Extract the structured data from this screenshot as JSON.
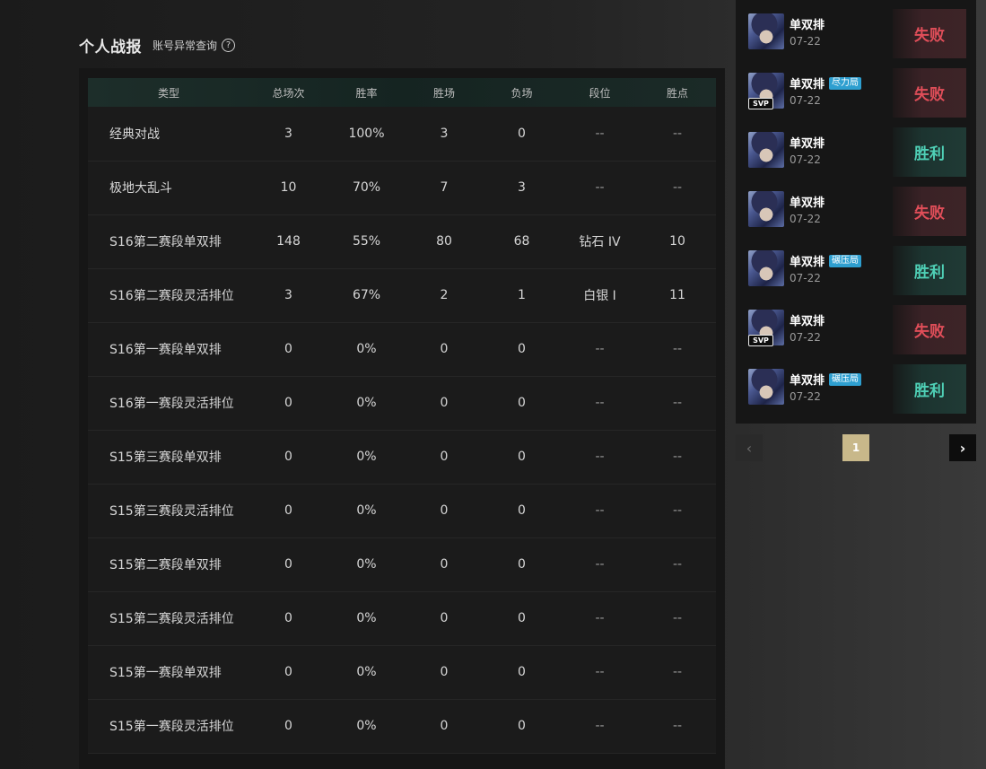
{
  "stats": {
    "title": "个人战报",
    "abnormal_link": "账号异常查询",
    "help_icon": "?",
    "columns": [
      "类型",
      "总场次",
      "胜率",
      "胜场",
      "负场",
      "段位",
      "胜点"
    ],
    "rows": [
      {
        "type": "经典对战",
        "total": "3",
        "winrate": "100%",
        "wins": "3",
        "losses": "0",
        "rank": "--",
        "lp": "--"
      },
      {
        "type": "极地大乱斗",
        "total": "10",
        "winrate": "70%",
        "wins": "7",
        "losses": "3",
        "rank": "--",
        "lp": "--"
      },
      {
        "type": "S16第二赛段单双排",
        "total": "148",
        "winrate": "55%",
        "wins": "80",
        "losses": "68",
        "rank": "钻石 IV",
        "lp": "10"
      },
      {
        "type": "S16第二赛段灵活排位",
        "total": "3",
        "winrate": "67%",
        "wins": "2",
        "losses": "1",
        "rank": "白银 Ⅰ",
        "lp": "11"
      },
      {
        "type": "S16第一赛段单双排",
        "total": "0",
        "winrate": "0%",
        "wins": "0",
        "losses": "0",
        "rank": "--",
        "lp": "--"
      },
      {
        "type": "S16第一赛段灵活排位",
        "total": "0",
        "winrate": "0%",
        "wins": "0",
        "losses": "0",
        "rank": "--",
        "lp": "--"
      },
      {
        "type": "S15第三赛段单双排",
        "total": "0",
        "winrate": "0%",
        "wins": "0",
        "losses": "0",
        "rank": "--",
        "lp": "--"
      },
      {
        "type": "S15第三赛段灵活排位",
        "total": "0",
        "winrate": "0%",
        "wins": "0",
        "losses": "0",
        "rank": "--",
        "lp": "--"
      },
      {
        "type": "S15第二赛段单双排",
        "total": "0",
        "winrate": "0%",
        "wins": "0",
        "losses": "0",
        "rank": "--",
        "lp": "--"
      },
      {
        "type": "S15第二赛段灵活排位",
        "total": "0",
        "winrate": "0%",
        "wins": "0",
        "losses": "0",
        "rank": "--",
        "lp": "--"
      },
      {
        "type": "S15第一赛段单双排",
        "total": "0",
        "winrate": "0%",
        "wins": "0",
        "losses": "0",
        "rank": "--",
        "lp": "--"
      },
      {
        "type": "S15第一赛段灵活排位",
        "total": "0",
        "winrate": "0%",
        "wins": "0",
        "losses": "0",
        "rank": "--",
        "lp": "--"
      }
    ]
  },
  "matches": [
    {
      "mode": "单双排",
      "tag": "",
      "svp": "",
      "date": "07-22",
      "result": "失败",
      "outcome": "lose",
      "avatar_icon": "champion-avatar-icon"
    },
    {
      "mode": "单双排",
      "tag": "尽力局",
      "svp": "SVP",
      "date": "07-22",
      "result": "失败",
      "outcome": "lose",
      "avatar_icon": "champion-avatar-icon"
    },
    {
      "mode": "单双排",
      "tag": "",
      "svp": "",
      "date": "07-22",
      "result": "胜利",
      "outcome": "win",
      "avatar_icon": "champion-avatar-icon"
    },
    {
      "mode": "单双排",
      "tag": "",
      "svp": "",
      "date": "07-22",
      "result": "失败",
      "outcome": "lose",
      "avatar_icon": "champion-avatar-icon"
    },
    {
      "mode": "单双排",
      "tag": "碾压局",
      "svp": "",
      "date": "07-22",
      "result": "胜利",
      "outcome": "win",
      "avatar_icon": "champion-avatar-icon"
    },
    {
      "mode": "单双排",
      "tag": "",
      "svp": "SVP",
      "date": "07-22",
      "result": "失败",
      "outcome": "lose",
      "avatar_icon": "champion-avatar-icon"
    },
    {
      "mode": "单双排",
      "tag": "碾压局",
      "svp": "",
      "date": "07-22",
      "result": "胜利",
      "outcome": "win",
      "avatar_icon": "champion-avatar-icon"
    }
  ],
  "pagination": {
    "prev_icon": "chevron-left-icon",
    "prev_glyph": "‹",
    "current_page": "1",
    "next_icon": "chevron-right-icon",
    "next_glyph": "›"
  },
  "colors": {
    "win": "#4fd0b6",
    "lose": "#e04e59",
    "tag_bg": "#2e9fd0",
    "active_page": "#c8b88a",
    "table_header_bg": "#1d2e2a"
  }
}
